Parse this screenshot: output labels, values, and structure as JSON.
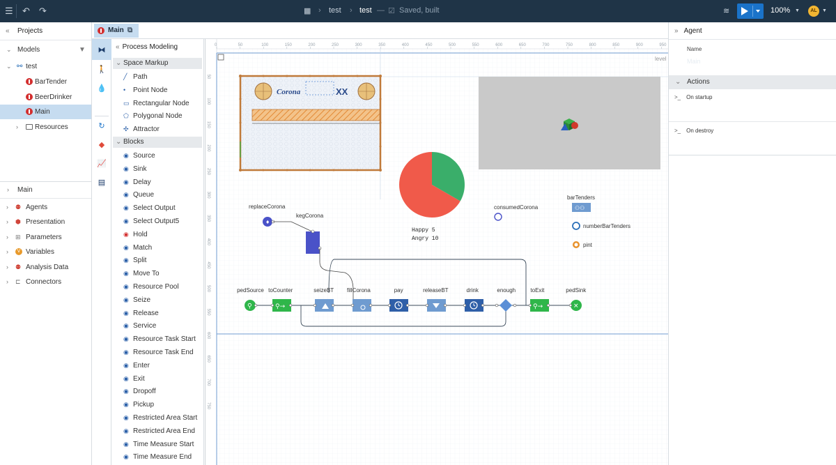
{
  "toolbar": {
    "title_path": "test",
    "title": "test",
    "separator": "—",
    "status": "Saved, built",
    "zoom": "100%",
    "avatar_initials": "AL"
  },
  "projects": {
    "header": "Projects",
    "models_label": "Models",
    "tree": [
      {
        "label": "test",
        "level": 0
      },
      {
        "label": "BarTender",
        "level": 1
      },
      {
        "label": "BeerDrinker",
        "level": 1
      },
      {
        "label": "Main",
        "level": 1
      },
      {
        "label": "Resources",
        "level": 1
      }
    ]
  },
  "outline": {
    "header": "Main",
    "items": [
      "Agents",
      "Presentation",
      "Parameters",
      "Variables",
      "Analysis Data",
      "Connectors"
    ]
  },
  "tab": {
    "label": "Main"
  },
  "palette": {
    "header": "Process Modeling",
    "space_markup": "Space Markup",
    "space_items": [
      "Path",
      "Point Node",
      "Rectangular Node",
      "Polygonal Node",
      "Attractor"
    ],
    "blocks": "Blocks",
    "block_items": [
      "Source",
      "Sink",
      "Delay",
      "Queue",
      "Select Output",
      "Select Output5",
      "Hold",
      "Match",
      "Split",
      "Move To",
      "Resource Pool",
      "Seize",
      "Release",
      "Service",
      "Resource Task Start",
      "Resource Task End",
      "Enter",
      "Exit",
      "Dropoff",
      "Pickup",
      "Restricted Area Start",
      "Restricted Area End",
      "Time Measure Start",
      "Time Measure End"
    ]
  },
  "canvas": {
    "ruler_marks": [
      "0",
      "50",
      "100",
      "150",
      "200",
      "250",
      "300",
      "350",
      "400",
      "450",
      "500",
      "550",
      "600",
      "650",
      "700",
      "750",
      "800",
      "850",
      "900",
      "950"
    ],
    "vruler_marks": [
      "50",
      "100",
      "150",
      "200",
      "250",
      "300",
      "350",
      "400",
      "450",
      "500",
      "550",
      "600",
      "650",
      "700",
      "750"
    ],
    "level_label": "level",
    "corona_text": "Corona",
    "xx_text": "XX",
    "labels": {
      "replace": "replaceCorona",
      "keg": "kegCorona",
      "consumed": "consumedCorona",
      "bartenders": "barTenders",
      "number": "numberBarTenders",
      "pint": "pint",
      "happy": "Happy 5",
      "angry": "Angry 10"
    },
    "flow": [
      "pedSource",
      "toCounter",
      "seizeBT",
      "fillCorona",
      "pay",
      "releaseBT",
      "drink",
      "enough",
      "toExit",
      "pedSink"
    ]
  },
  "chart_data": {
    "type": "pie",
    "categories": [
      "Happy",
      "Angry"
    ],
    "values": [
      5,
      10
    ],
    "colors": [
      "#3aae6a",
      "#f05a4a"
    ]
  },
  "agent": {
    "header": "Agent",
    "name_label": "Name",
    "name_value": "Main",
    "actions": "Actions",
    "on_startup": "On startup",
    "on_destroy": "On destroy"
  },
  "colors": {
    "topbar": "#1f3447",
    "accent": "#1a73c9",
    "selection": "#c6dcf0",
    "block_blue": "#2f5fa8",
    "block_green": "#2fb64a"
  }
}
